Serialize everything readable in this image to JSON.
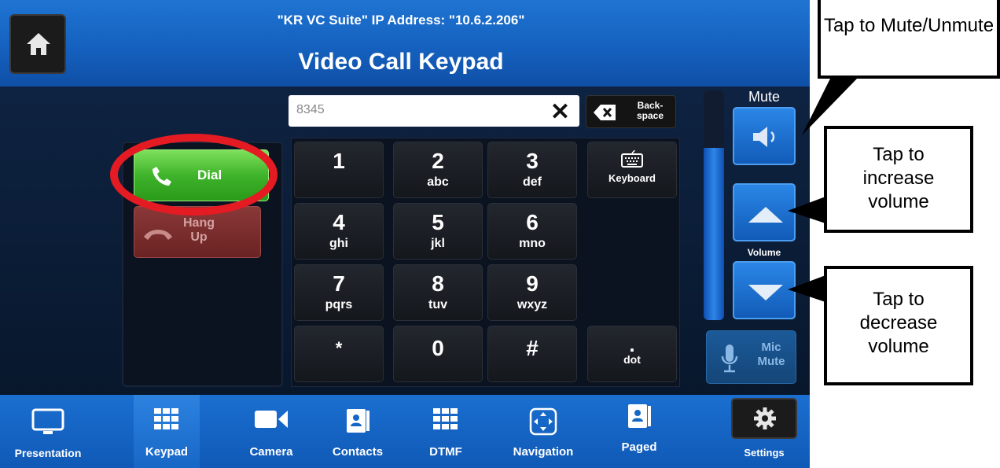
{
  "header": {
    "ip_line": "\"KR VC Suite\" IP Address: \"10.6.2.206\"",
    "title": "Video Call Keypad"
  },
  "dial": {
    "label": "Dial",
    "hangup_line1": "Hang",
    "hangup_line2": "Up"
  },
  "number_field": {
    "value": "8345",
    "clear": "✕"
  },
  "backspace": {
    "line1": "Back-",
    "line2": "space"
  },
  "keypad": {
    "keys": [
      {
        "digit": "1",
        "letters": ""
      },
      {
        "digit": "2",
        "letters": "abc"
      },
      {
        "digit": "3",
        "letters": "def"
      },
      {
        "digit": "",
        "letters": "Keyboard"
      },
      {
        "digit": "4",
        "letters": "ghi"
      },
      {
        "digit": "5",
        "letters": "jkl"
      },
      {
        "digit": "6",
        "letters": "mno"
      },
      {
        "digit": "7",
        "letters": "pqrs"
      },
      {
        "digit": "8",
        "letters": "tuv"
      },
      {
        "digit": "9",
        "letters": "wxyz"
      },
      {
        "digit": "*",
        "letters": ""
      },
      {
        "digit": "0",
        "letters": ""
      },
      {
        "digit": "#",
        "letters": ""
      },
      {
        "digit": ".",
        "letters": "dot"
      }
    ]
  },
  "volume": {
    "mute_label": "Mute",
    "volume_label": "Volume",
    "level_fraction": 0.75
  },
  "mic_mute": {
    "line1": "Mic",
    "line2": "Mute"
  },
  "tabs": [
    {
      "label": "Presentation",
      "icon": "monitor-icon"
    },
    {
      "label": "Keypad",
      "icon": "keypad-grid-icon"
    },
    {
      "label": "Camera",
      "icon": "video-camera-icon"
    },
    {
      "label": "Contacts",
      "icon": "contacts-book-icon"
    },
    {
      "label": "DTMF",
      "icon": "dtmf-grid-icon"
    },
    {
      "label": "Navigation",
      "icon": "navigation-arrows-icon"
    },
    {
      "label": "Paged",
      "icon": "paged-book-icon"
    }
  ],
  "settings": {
    "label": "Settings"
  },
  "callouts": {
    "mute": "Tap to Mute/Unmute",
    "increase": "Tap to increase volume",
    "decrease": "Tap to decrease volume"
  },
  "colors": {
    "header_blue": "#1561bf",
    "dial_green": "#3fb32b",
    "hangup_red": "#6b2323",
    "annotation_ring": "#e41b23"
  }
}
